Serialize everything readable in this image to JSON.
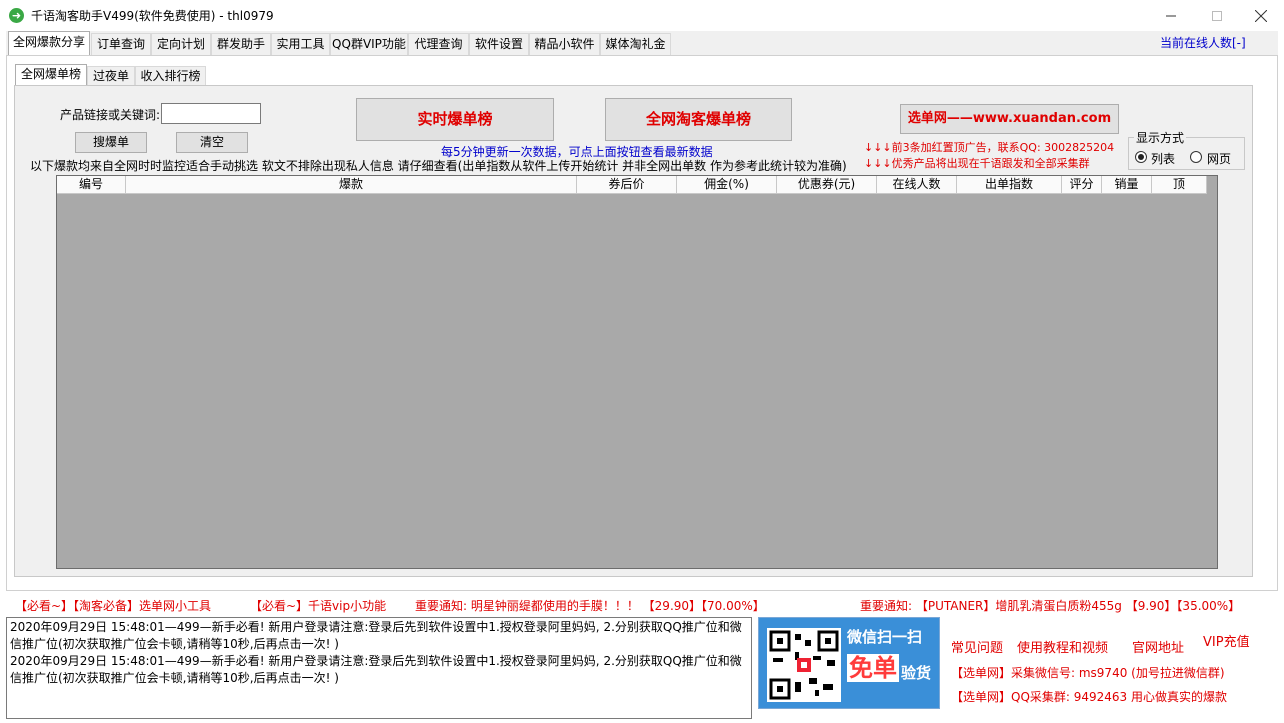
{
  "window": {
    "title": "千语淘客助手V499(软件免费使用) - thl0979"
  },
  "main_tabs": [
    {
      "label": "全网爆款分享",
      "active": true
    },
    {
      "label": "订单查询"
    },
    {
      "label": "定向计划"
    },
    {
      "label": "群发助手"
    },
    {
      "label": "实用工具"
    },
    {
      "label": "QQ群VIP功能"
    },
    {
      "label": "代理查询"
    },
    {
      "label": "软件设置"
    },
    {
      "label": "精品小软件"
    },
    {
      "label": "媒体淘礼金"
    }
  ],
  "online_count": "当前在线人数[-]",
  "sub_tabs": [
    {
      "label": "全网爆单榜",
      "active": true
    },
    {
      "label": "过夜单"
    },
    {
      "label": "收入排行榜"
    }
  ],
  "search": {
    "label": "产品链接或关键词:",
    "value": "",
    "search_button": "搜爆单",
    "clear_button": "清空"
  },
  "buttons": {
    "realtime": "实时爆单榜",
    "network": "全网淘客爆单榜",
    "xuandan": "选单网——www.xuandan.com"
  },
  "notes": {
    "update_hint": "每5分钟更新一次数据，可点上面按钮查看最新数据",
    "source_note": "以下爆款均来自全网时时监控适合手动挑选 软文不排除出现私人信息 请仔细查看(出单指数从软件上传开始统计 并非全网出单数 作为参考此统计较为准确)",
    "ad_line1": "↓↓↓前3条加红置顶广告，联系QQ: 3002825204",
    "ad_line2": "↓↓↓优秀产品将出现在千语跟发和全部采集群"
  },
  "display_mode": {
    "title": "显示方式",
    "options": [
      "列表",
      "网页"
    ],
    "selected": "列表"
  },
  "table": {
    "columns": [
      "编号",
      "爆款",
      "券后价",
      "佣金(%)",
      "优惠券(元)",
      "在线人数",
      "出单指数",
      "评分",
      "销量",
      "顶"
    ],
    "rows": []
  },
  "tickers": {
    "item1": "【必看~】【淘客必备】选单网小工具",
    "item2": "【必看~】千语vip小功能",
    "item3": "重要通知: 明星钟丽缇都使用的手膜！！！ 【29.90】【70.00%】",
    "item4": "重要通知: 【PUTANER】增肌乳清蛋白质粉455g 【9.90】【35.00%】"
  },
  "log": [
    "2020年09月29日 15:48:01—499—新手必看! 新用户登录请注意:登录后先到软件设置中1.授权登录阿里妈妈, 2.分别获取QQ推广位和微信推广位(初次获取推广位会卡顿,请稍等10秒,后再点击一次! )",
    "2020年09月29日 15:48:01—499—新手必看! 新用户登录请注意:登录后先到软件设置中1.授权登录阿里妈妈, 2.分别获取QQ推广位和微信推广位(初次获取推广位会卡顿,请稍等10秒,后再点击一次! )"
  ],
  "promo": {
    "line1": "微信扫一扫",
    "line2": "免单",
    "line3": "验货"
  },
  "links": {
    "faq": "常见问题",
    "tutorial": "使用教程和视频",
    "website": "官网地址",
    "vip": "VIP充值",
    "wechat": "【选单网】采集微信号: ms9740 (加号拉进微信群)",
    "qqgroup": "【选单网】QQ采集群: 9492463 用心做真实的爆款"
  }
}
